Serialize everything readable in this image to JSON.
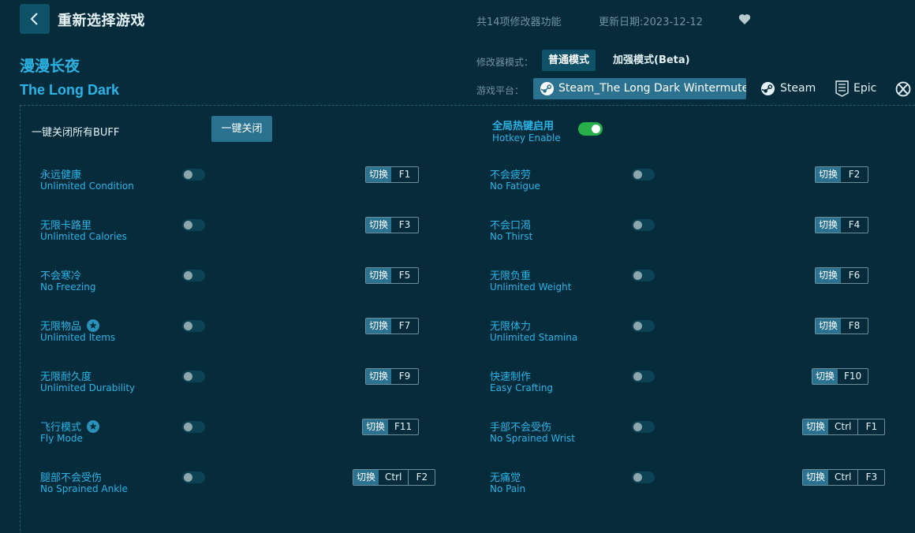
{
  "header": {
    "back_label": "返回",
    "title": "重新选择游戏",
    "feature_count": "共14项修改器功能",
    "update_date": "更新日期:2023-12-12"
  },
  "game": {
    "title_cn": "漫漫长夜",
    "title_en": "The Long Dark"
  },
  "modes": {
    "label": "修改器模式：",
    "normal": "普通模式",
    "enhanced": "加强模式(Beta)"
  },
  "platforms": {
    "label": "游戏平台：",
    "items": [
      "Steam_The Long Dark Wintermute",
      "Steam",
      "Epic"
    ]
  },
  "panel": {
    "buff_label": "一键关闭所有BUFF",
    "close_all": "一键关闭",
    "hotkey_title": "全局热键启用",
    "hotkey_sub": "Hotkey Enable"
  },
  "switch_label": "切换",
  "features": [
    {
      "cn": "永远健康",
      "en": "Unlimited Condition",
      "keys": [
        "F1"
      ],
      "on": false
    },
    {
      "cn": "不会疲劳",
      "en": "No Fatigue",
      "keys": [
        "F2"
      ],
      "on": false
    },
    {
      "cn": "无限卡路里",
      "en": "Unlimited Calories",
      "keys": [
        "F3"
      ],
      "on": false
    },
    {
      "cn": "不会口渴",
      "en": "No Thirst",
      "keys": [
        "F4"
      ],
      "on": false
    },
    {
      "cn": "不会寒冷",
      "en": "No Freezing",
      "keys": [
        "F5"
      ],
      "on": false
    },
    {
      "cn": "无限负重",
      "en": "Unlimited Weight",
      "keys": [
        "F6"
      ],
      "on": false
    },
    {
      "cn": "无限物品",
      "en": "Unlimited Items",
      "keys": [
        "F7"
      ],
      "on": false,
      "star": true
    },
    {
      "cn": "无限体力",
      "en": "Unlimited Stamina",
      "keys": [
        "F8"
      ],
      "on": false
    },
    {
      "cn": "无限耐久度",
      "en": "Unlimited Durability",
      "keys": [
        "F9"
      ],
      "on": false
    },
    {
      "cn": "快速制作",
      "en": "Easy Crafting",
      "keys": [
        "F10"
      ],
      "on": false
    },
    {
      "cn": "飞行模式",
      "en": "Fly Mode",
      "keys": [
        "F11"
      ],
      "on": false,
      "star": true
    },
    {
      "cn": "手部不会受伤",
      "en": "No Sprained Wrist",
      "keys": [
        "Ctrl",
        "F1"
      ],
      "on": false
    },
    {
      "cn": "腿部不会受伤",
      "en": "No Sprained Ankle",
      "keys": [
        "Ctrl",
        "F2"
      ],
      "on": false
    },
    {
      "cn": "无痛觉",
      "en": "No Pain",
      "keys": [
        "Ctrl",
        "F3"
      ],
      "on": false
    }
  ],
  "colors": {
    "background": "#062c3c",
    "accent": "#2bb3e6",
    "button": "#2a7290",
    "toggle_on": "#27b04a"
  }
}
